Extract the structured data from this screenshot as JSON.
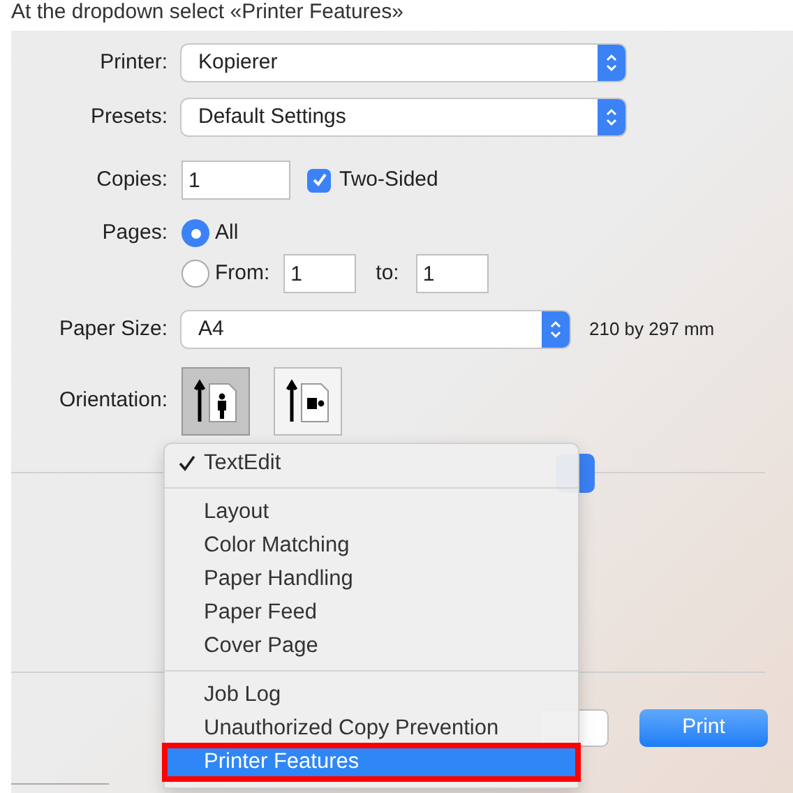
{
  "caption": "At the dropdown select «Printer Features»",
  "printer": {
    "label": "Printer:",
    "value": "Kopierer"
  },
  "presets": {
    "label": "Presets:",
    "value": "Default Settings"
  },
  "copies": {
    "label": "Copies:",
    "value": "1",
    "two_sided": {
      "label": "Two-Sided",
      "checked": true
    }
  },
  "pages": {
    "label": "Pages:",
    "options": [
      {
        "label": "All",
        "selected": true
      },
      {
        "label": "From:",
        "selected": false
      }
    ],
    "from": "1",
    "to_label": "to:",
    "to": "1"
  },
  "paper_size": {
    "label": "Paper Size:",
    "value": "A4",
    "dimensions": "210 by 297 mm"
  },
  "orientation": {
    "label": "Orientation:",
    "options": [
      {
        "kind": "portrait",
        "selected": true
      },
      {
        "kind": "landscape",
        "selected": false
      }
    ]
  },
  "menu": {
    "sections": [
      [
        {
          "label": "TextEdit",
          "checked": true,
          "selected": false,
          "highlighted": false
        }
      ],
      [
        {
          "label": "Layout",
          "checked": false,
          "selected": false,
          "highlighted": false
        },
        {
          "label": "Color Matching",
          "checked": false,
          "selected": false,
          "highlighted": false
        },
        {
          "label": "Paper Handling",
          "checked": false,
          "selected": false,
          "highlighted": false
        },
        {
          "label": "Paper Feed",
          "checked": false,
          "selected": false,
          "highlighted": false
        },
        {
          "label": "Cover Page",
          "checked": false,
          "selected": false,
          "highlighted": false
        }
      ],
      [
        {
          "label": "Job Log",
          "checked": false,
          "selected": false,
          "highlighted": false
        },
        {
          "label": "Unauthorized Copy Prevention",
          "checked": false,
          "selected": false,
          "highlighted": false
        },
        {
          "label": "Printer Features",
          "checked": false,
          "selected": true,
          "highlighted": true
        }
      ]
    ]
  },
  "print_button": "Print"
}
